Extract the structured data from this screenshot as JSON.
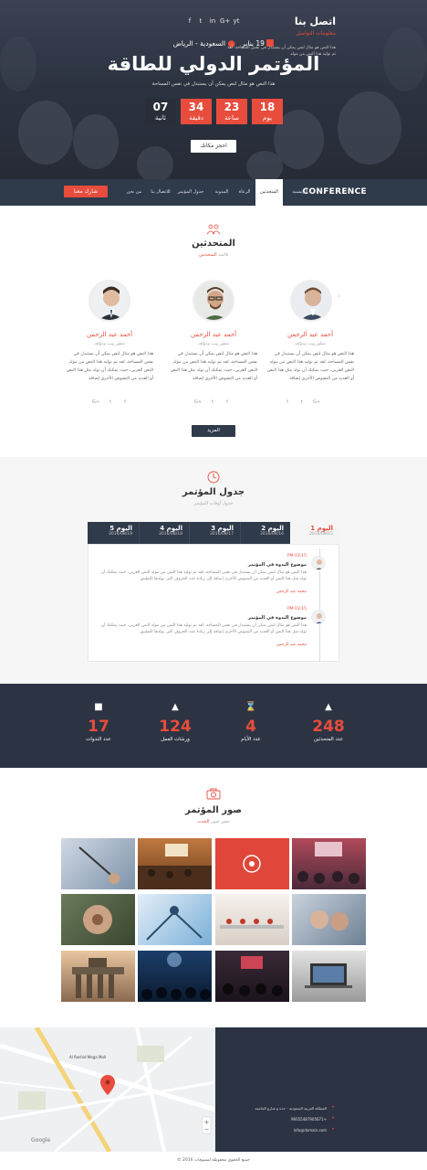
{
  "hero": {
    "date_text": "19 يناير",
    "location_text": "السعودية - الرياض",
    "title": "المؤتمر الدولي للطاقة",
    "subtitle": "هذا النص هو مثال لنص يمكن أن يستبدل في نفس المساحة",
    "countdown": [
      {
        "value": "18",
        "label": "يوم"
      },
      {
        "value": "23",
        "label": "ساعة"
      },
      {
        "value": "34",
        "label": "دقيقة"
      },
      {
        "value": "07",
        "label": "ثانية"
      }
    ],
    "book_label": "احجز مكانك",
    "social": [
      "f",
      "t",
      "in",
      "G+",
      "yt"
    ]
  },
  "nav": {
    "brand": "CONFERENCE",
    "items": [
      "الرئيسية",
      "المتحدثين",
      "الرعاة",
      "المدونة",
      "جدول المؤتمر",
      "للاتصال بنا",
      "من نحن"
    ],
    "join_label": "شارك معنا"
  },
  "speakers": {
    "title": "المتحدثين",
    "subtitle_prefix": "قائمة",
    "subtitle_highlight": "المتحدثين",
    "items": [
      {
        "name": "أحمد عبد الرحمن",
        "role": "مطور ويب ومؤلف",
        "bio": "هذا النص هو مثال لنص يمكن أن يستبدل في نفس المساحة، لقد تم توليد هذا النص من مولد النص العربي، حيث يمكنك أن تولد مثل هذا النص أو العديد من النصوص الأخرى إضافة"
      },
      {
        "name": "أحمد عبد الرحمن",
        "role": "مطور ويب ومؤلف",
        "bio": "هذا النص هو مثال لنص يمكن أن يستبدل في نفس المساحة، لقد تم توليد هذا النص من مولد النص العربي، حيث يمكنك أن تولد مثل هذا النص أو العديد من النصوص الأخرى إضافة"
      },
      {
        "name": "أحمد عبد الرحمن",
        "role": "مطور ويب ومؤلف",
        "bio": "هذا النص هو مثال لنص يمكن أن يستبدل في نفس المساحة، لقد تم توليد هذا النص من مولد النص العربي، حيث يمكنك أن تولد مثل هذا النص أو العديد من النصوص الأخرى إضافة"
      }
    ],
    "more_label": "المزيد"
  },
  "schedule": {
    "title": "جدول المؤتمر",
    "subtitle": "جدول أوقات المؤتمر",
    "days": [
      {
        "label": "اليوم 1",
        "date": "2016/08/15"
      },
      {
        "label": "اليوم 2",
        "date": "2016/08/16"
      },
      {
        "label": "اليوم 3",
        "date": "2016/08/17"
      },
      {
        "label": "اليوم 4",
        "date": "2016/08/18"
      },
      {
        "label": "اليوم 5",
        "date": "2016/08/19"
      }
    ],
    "events": [
      {
        "time": "PM 03:15",
        "title": "موضوع الندوة في المؤتمر",
        "desc": "هذا النص هو مثال لنص يمكن أن يستبدل في نفس المساحة، لقد تم توليد هذا النص من مولد النص العربي، حيث يمكنك أن تولد مثل هذا النص أو العديد من النصوص الأخرى إضافة إلى زيادة عدد الحروف التى يولدها التطبيق",
        "speaker": "محمد عبد الرحمن"
      },
      {
        "time": "PM 03:15",
        "title": "موضوع الندوة في المؤتمر",
        "desc": "هذا النص هو مثال لنص يمكن أن يستبدل في نفس المساحة، لقد تم توليد هذا النص من مولد النص العربي، حيث يمكنك أن تولد مثل هذا النص أو العديد من النصوص الأخرى إضافة إلى زيادة عدد الحروف التى يولدها التطبيق",
        "speaker": "محمد عبد الرحمن"
      }
    ]
  },
  "stats": [
    {
      "value": "248",
      "label": "عدد المتحدثين",
      "icon": "megaphone-icon"
    },
    {
      "value": "4",
      "label": "عدد الأيام",
      "icon": "hourglass-icon"
    },
    {
      "value": "124",
      "label": "ورشات العمل",
      "icon": "network-icon"
    },
    {
      "value": "17",
      "label": "عدد الندوات",
      "icon": "presentation-icon"
    }
  ],
  "gallery": {
    "title": "صور المؤتمر",
    "subtitle_prefix": "بعض صور",
    "subtitle_highlight": "الحدث"
  },
  "contact": {
    "title": "اتصل بنا",
    "subtitle": "معلومات التواصل",
    "desc": "هذا النص هو مثال لنص يمكن أن يستبدل في نفس المساحة، لقد تم توليد هذا النص من مولد",
    "address": "المملكة العربية السعودية - جدة و شارع الجامعة",
    "phone": "+96655487905671",
    "email": "info@domain.com",
    "map_labels": [
      "Al Rashid Mega Mall",
      "Google"
    ]
  },
  "footer": {
    "text": "جميع الحقوق محفوظة لمسوقات 2016 ©"
  }
}
